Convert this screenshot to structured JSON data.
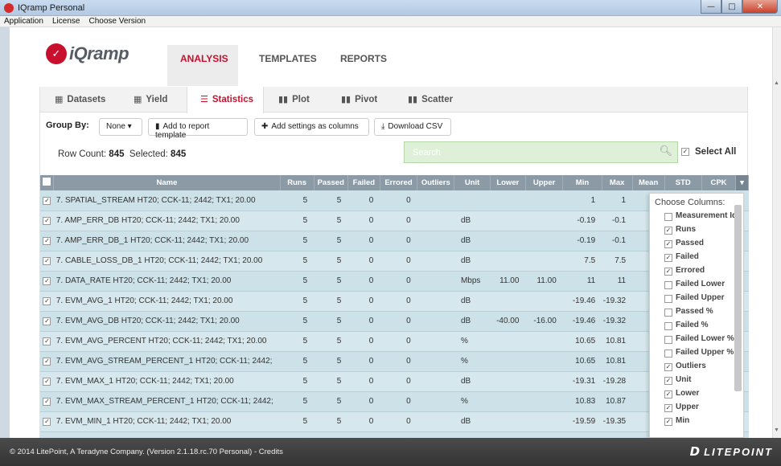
{
  "window": {
    "title": "IQramp Personal",
    "min_symbol": "—",
    "max_symbol": "□",
    "close_symbol": "✕"
  },
  "menu": [
    "Application",
    "License",
    "Choose Version"
  ],
  "brand": {
    "mark": "✓",
    "text": "iQramp"
  },
  "topnav": {
    "tabs": [
      "ANALYSIS",
      "TEMPLATES",
      "REPORTS"
    ],
    "active": "ANALYSIS"
  },
  "subtabs": [
    {
      "label": "Datasets",
      "icon": "▦"
    },
    {
      "label": "Yield",
      "icon": "▦"
    },
    {
      "label": "Statistics",
      "icon": "☰"
    },
    {
      "label": "Plot",
      "icon": "▮▮"
    },
    {
      "label": "Pivot",
      "icon": "▮▮"
    },
    {
      "label": "Scatter",
      "icon": "▮▮"
    }
  ],
  "toolbar": {
    "group_by_label": "Group By:",
    "group_by_value": "None ▾",
    "add_template_label": "Add to report template",
    "add_columns_label": "Add settings as columns",
    "download_label": "Download CSV"
  },
  "counts": {
    "row_count_label": "Row Count:",
    "row_count": "845",
    "selected_label": "Selected:",
    "selected": "845"
  },
  "search": {
    "placeholder": "Search"
  },
  "select_all_label": "Select All",
  "columns": [
    "Name",
    "Runs",
    "Passed",
    "Failed",
    "Errored",
    "Outliers",
    "Unit",
    "Lower",
    "Upper",
    "Min",
    "Max",
    "Mean",
    "STD",
    "CPK"
  ],
  "rows": [
    {
      "name": "7. SPATIAL_STREAM HT20; CCK-11; 2442; TX1; 20.00",
      "runs": "5",
      "passed": "5",
      "failed": "0",
      "errored": "0",
      "outliers": "",
      "unit": "",
      "lower": "",
      "upper": "",
      "min": "1",
      "max": "1"
    },
    {
      "name": "7. AMP_ERR_DB HT20; CCK-11; 2442; TX1; 20.00",
      "runs": "5",
      "passed": "5",
      "failed": "0",
      "errored": "0",
      "outliers": "",
      "unit": "dB",
      "lower": "",
      "upper": "",
      "min": "-0.19",
      "max": "-0.1"
    },
    {
      "name": "7. AMP_ERR_DB_1 HT20; CCK-11; 2442; TX1; 20.00",
      "runs": "5",
      "passed": "5",
      "failed": "0",
      "errored": "0",
      "outliers": "",
      "unit": "dB",
      "lower": "",
      "upper": "",
      "min": "-0.19",
      "max": "-0.1"
    },
    {
      "name": "7. CABLE_LOSS_DB_1 HT20; CCK-11; 2442; TX1; 20.00",
      "runs": "5",
      "passed": "5",
      "failed": "0",
      "errored": "0",
      "outliers": "",
      "unit": "dB",
      "lower": "",
      "upper": "",
      "min": "7.5",
      "max": "7.5"
    },
    {
      "name": "7. DATA_RATE HT20; CCK-11; 2442; TX1; 20.00",
      "runs": "5",
      "passed": "5",
      "failed": "0",
      "errored": "0",
      "outliers": "",
      "unit": "Mbps",
      "lower": "11.00",
      "upper": "11.00",
      "min": "11",
      "max": "11"
    },
    {
      "name": "7. EVM_AVG_1 HT20; CCK-11; 2442; TX1; 20.00",
      "runs": "5",
      "passed": "5",
      "failed": "0",
      "errored": "0",
      "outliers": "",
      "unit": "dB",
      "lower": "",
      "upper": "",
      "min": "-19.46",
      "max": "-19.32"
    },
    {
      "name": "7. EVM_AVG_DB HT20; CCK-11; 2442; TX1; 20.00",
      "runs": "5",
      "passed": "5",
      "failed": "0",
      "errored": "0",
      "outliers": "",
      "unit": "dB",
      "lower": "-40.00",
      "upper": "-16.00",
      "min": "-19.46",
      "max": "-19.32"
    },
    {
      "name": "7. EVM_AVG_PERCENT HT20; CCK-11; 2442; TX1; 20.00",
      "runs": "5",
      "passed": "5",
      "failed": "0",
      "errored": "0",
      "outliers": "",
      "unit": "%",
      "lower": "",
      "upper": "",
      "min": "10.65",
      "max": "10.81"
    },
    {
      "name": "7. EVM_AVG_STREAM_PERCENT_1 HT20; CCK-11; 2442;",
      "runs": "5",
      "passed": "5",
      "failed": "0",
      "errored": "0",
      "outliers": "",
      "unit": "%",
      "lower": "",
      "upper": "",
      "min": "10.65",
      "max": "10.81"
    },
    {
      "name": "7. EVM_MAX_1 HT20; CCK-11; 2442; TX1; 20.00",
      "runs": "5",
      "passed": "5",
      "failed": "0",
      "errored": "0",
      "outliers": "",
      "unit": "dB",
      "lower": "",
      "upper": "",
      "min": "-19.31",
      "max": "-19.28"
    },
    {
      "name": "7. EVM_MAX_STREAM_PERCENT_1 HT20; CCK-11; 2442;",
      "runs": "5",
      "passed": "5",
      "failed": "0",
      "errored": "0",
      "outliers": "",
      "unit": "%",
      "lower": "",
      "upper": "",
      "min": "10.83",
      "max": "10.87"
    },
    {
      "name": "7. EVM_MIN_1 HT20; CCK-11; 2442; TX1; 20.00",
      "runs": "5",
      "passed": "5",
      "failed": "0",
      "errored": "0",
      "outliers": "",
      "unit": "dB",
      "lower": "",
      "upper": "",
      "min": "-19.59",
      "max": "-19.35"
    }
  ],
  "column_chooser": {
    "title": "Choose Columns:",
    "items": [
      {
        "label": "Measurement Id",
        "checked": false
      },
      {
        "label": "Runs",
        "checked": true
      },
      {
        "label": "Passed",
        "checked": true
      },
      {
        "label": "Failed",
        "checked": true
      },
      {
        "label": "Errored",
        "checked": true
      },
      {
        "label": "Failed Lower",
        "checked": false
      },
      {
        "label": "Failed Upper",
        "checked": false
      },
      {
        "label": "Passed %",
        "checked": false
      },
      {
        "label": "Failed %",
        "checked": false
      },
      {
        "label": "Failed Lower %",
        "checked": false
      },
      {
        "label": "Failed Upper %",
        "checked": false
      },
      {
        "label": "Outliers",
        "checked": true
      },
      {
        "label": "Unit",
        "checked": true
      },
      {
        "label": "Lower",
        "checked": true
      },
      {
        "label": "Upper",
        "checked": true
      },
      {
        "label": "Min",
        "checked": true
      }
    ]
  },
  "footer": {
    "copyright": "© 2014 LitePoint, A Teradyne Company. (Version 2.1.18.rc.70 Personal) - Credits",
    "logo_mark": "D",
    "logo_text": "LITEPOINT"
  },
  "colors": {
    "accent": "#c8102e",
    "header_bg": "#8c9aa6",
    "row_bg": "#cde1e8",
    "search_bg": "#dff0d8"
  }
}
